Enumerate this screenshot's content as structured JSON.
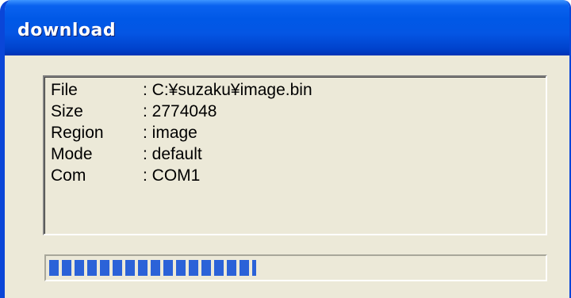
{
  "window": {
    "title": "download"
  },
  "info": {
    "rows": [
      {
        "label": "File",
        "value": ": C:¥suzaku¥image.bin"
      },
      {
        "label": "Size",
        "value": ": 2774048"
      },
      {
        "label": "Region",
        "value": ": image"
      },
      {
        "label": "Mode",
        "value": ": default"
      },
      {
        "label": "Com",
        "value": ": COM1"
      }
    ]
  },
  "progress": {
    "fraction": 0.42
  },
  "colors": {
    "titlebar": "#0058e6",
    "window_bg": "#ece9d8",
    "progress_fill": "#2b62d8"
  }
}
